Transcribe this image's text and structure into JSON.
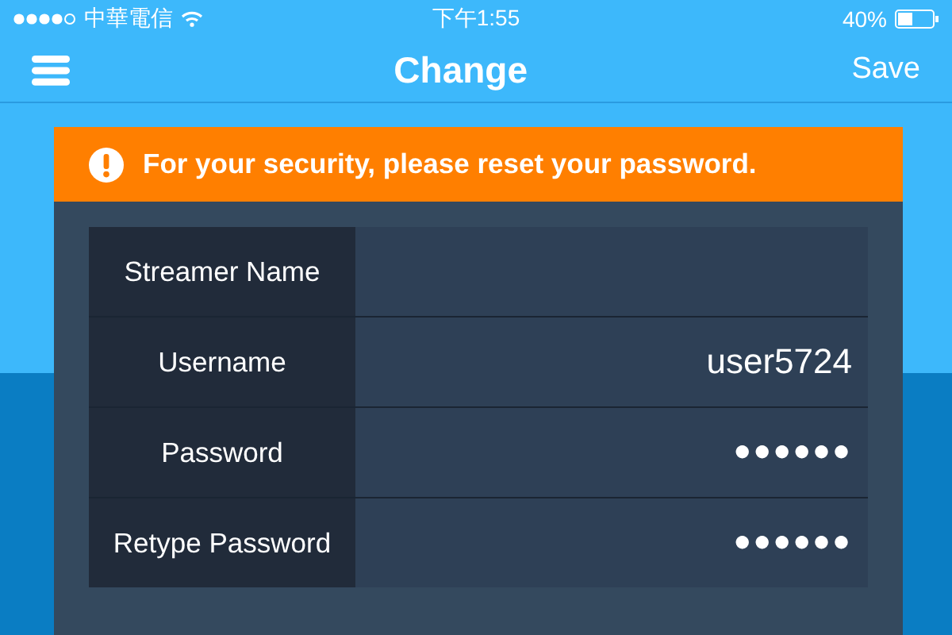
{
  "status_bar": {
    "carrier": "中華電信",
    "time": "下午1:55",
    "battery": "40%"
  },
  "nav": {
    "title": "Change",
    "action": "Save"
  },
  "alert": {
    "message": "For your security, please reset your password."
  },
  "fields": [
    {
      "label": "Streamer Name",
      "kind": "text"
    },
    {
      "label": "Username",
      "kind": "text",
      "value": "user5724"
    },
    {
      "label": "Password",
      "kind": "password",
      "value": "●●●●●●"
    },
    {
      "label": "Retype Password",
      "kind": "password",
      "value": "●●●●●●"
    }
  ]
}
